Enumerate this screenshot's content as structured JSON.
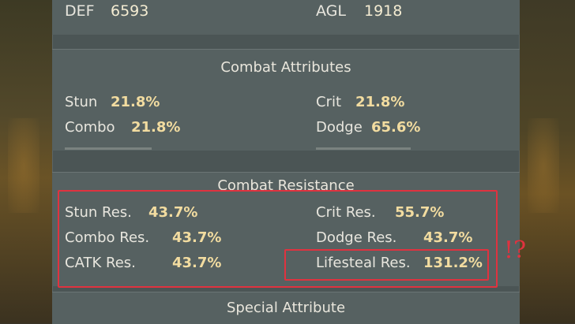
{
  "stats_top": {
    "def_label": "DEF",
    "def_value": "6593",
    "agl_label": "AGL",
    "agl_value": "1918"
  },
  "combat_attributes": {
    "title": "Combat Attributes",
    "rows": [
      {
        "label": "Stun",
        "value": "21.8%"
      },
      {
        "label": "Combo",
        "value": "21.8%"
      },
      {
        "label": "Crit",
        "value": "21.8%"
      },
      {
        "label": "Dodge",
        "value": "65.6%"
      }
    ]
  },
  "combat_resistance": {
    "title": "Combat Resistance",
    "rows": [
      {
        "label": "Stun Res.",
        "value": "43.7%"
      },
      {
        "label": "Combo Res.",
        "value": "43.7%"
      },
      {
        "label": "CATK Res.",
        "value": "43.7%"
      },
      {
        "label": "Crit Res.",
        "value": "55.7%"
      },
      {
        "label": "Dodge Res.",
        "value": "43.7%"
      },
      {
        "label": "Lifesteal Res.",
        "value": "131.2%"
      }
    ]
  },
  "special_attribute": {
    "title": "Special Attribute"
  },
  "annotation": {
    "mark": "!?",
    "color": "#e0323f"
  }
}
